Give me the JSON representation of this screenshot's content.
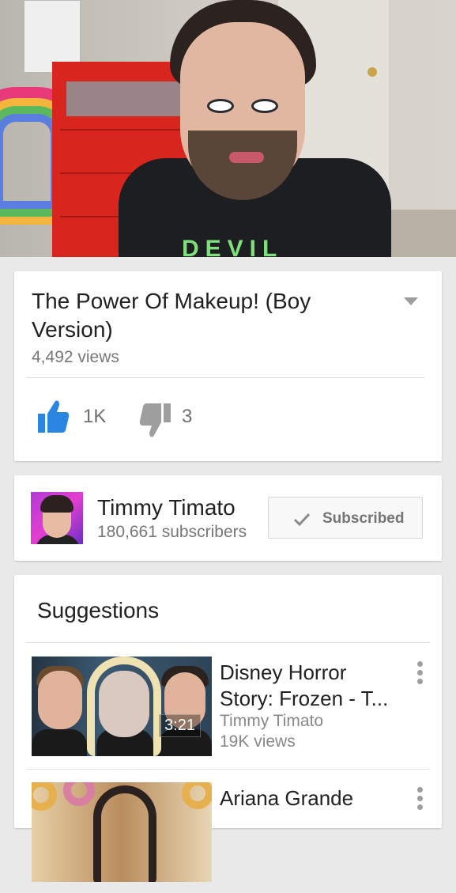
{
  "video": {
    "title": "The Power Of Makeup! (Boy Version)",
    "views": "4,492 views",
    "likes": "1K",
    "dislikes": "3",
    "shirt_text": "DEVIL"
  },
  "channel": {
    "name": "Timmy Timato",
    "subscribers": "180,661 subscribers",
    "subscribe_label": "Subscribed"
  },
  "suggestions": {
    "heading": "Suggestions",
    "items": [
      {
        "title": "Disney Horror Story: Frozen - T...",
        "channel": "Timmy Timato",
        "views": "19K views",
        "duration": "3:21"
      },
      {
        "title": "Ariana Grande",
        "channel": "",
        "views": "",
        "duration": ""
      }
    ]
  },
  "colors": {
    "like_blue": "#2a86e0",
    "icon_grey": "#9e9e9e"
  }
}
